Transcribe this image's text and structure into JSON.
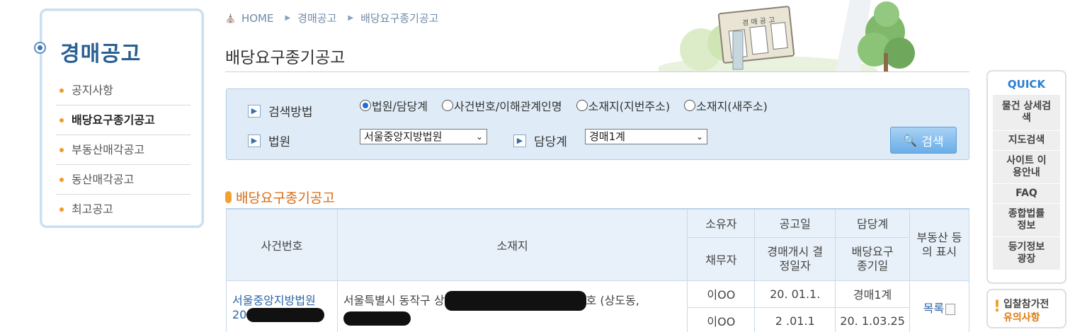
{
  "sidebar": {
    "title": "경매공고",
    "items": [
      {
        "label": "공지사항",
        "active": false
      },
      {
        "label": "배당요구종기공고",
        "active": true
      },
      {
        "label": "부동산매각공고",
        "active": false
      },
      {
        "label": "동산매각공고",
        "active": false
      },
      {
        "label": "최고공고",
        "active": false
      }
    ]
  },
  "breadcrumb": {
    "home": "HOME",
    "level1": "경매공고",
    "level2": "배당요구종기공고"
  },
  "page_title": "배당요구종기공고",
  "header_art": {
    "sign_text": "경 매 공 고"
  },
  "search": {
    "method_label": "검색방법",
    "methods": [
      {
        "label": "법원/담당계",
        "selected": true
      },
      {
        "label": "사건번호/이해관계인명",
        "selected": false
      },
      {
        "label": "소재지(지번주소)",
        "selected": false
      },
      {
        "label": "소재지(새주소)",
        "selected": false
      }
    ],
    "court_label": "법원",
    "court_value": "서울중앙지방법원",
    "dept_label": "담당계",
    "dept_value": "경매1계",
    "button_label": "검색"
  },
  "section_title": "배당요구종기공고",
  "table": {
    "headers": {
      "case_no": "사건번호",
      "location": "소재지",
      "owner": "소유자",
      "debtor": "채무자",
      "notice_date": "공고일",
      "auction_start_date": "경매개시 결정일자",
      "dept": "담당계",
      "deadline": "배당요구 종기일",
      "registry": "부동산 등의 표시"
    },
    "rows": [
      {
        "case_court": "서울중앙지방법원",
        "case_num_visible": "20",
        "location": "서울특별시 동작구 상",
        "location_suffix": "호 (상도동,",
        "owner": "이OO",
        "debtor": "이OO",
        "notice_date": "20.  01.1.",
        "auction_start_date": "2 .01.1",
        "dept": "경매1계",
        "deadline": "20.  1.03.25",
        "registry_link": "목록"
      }
    ]
  },
  "quick": {
    "title": "QUICK",
    "items": [
      "물건 상세검색",
      "지도검색",
      "사이트 이용안내",
      "FAQ",
      "종합법률 정보",
      "등기정보 광장"
    ]
  },
  "notice": {
    "line1": "입찰참가전",
    "line2": "유의사항"
  },
  "colors": {
    "accent_blue": "#2a5f93",
    "orange": "#d86a10",
    "search_bg": "#dfecf8"
  }
}
